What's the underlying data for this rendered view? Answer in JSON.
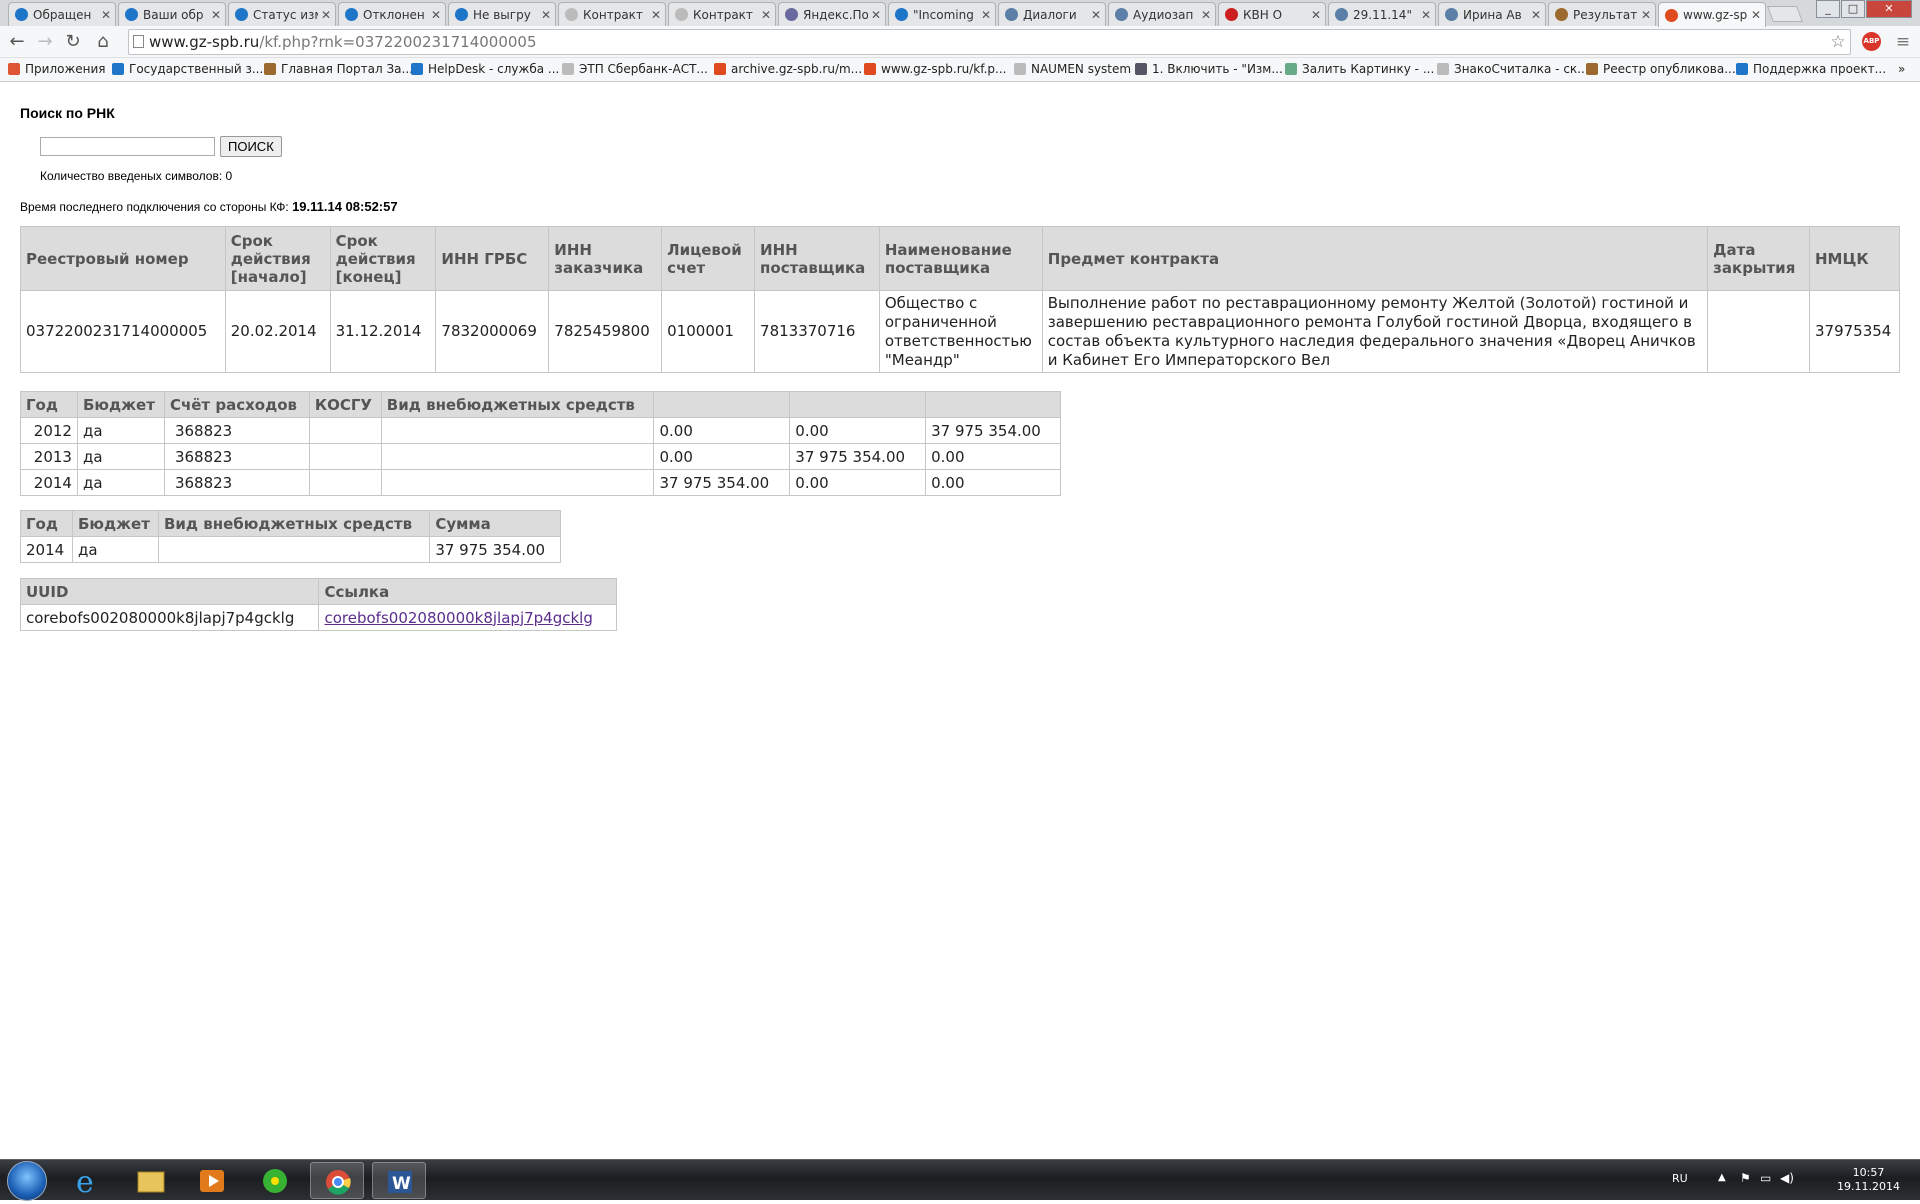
{
  "browser": {
    "tabs": [
      {
        "title": "Обращен",
        "color": "#1f76c9"
      },
      {
        "title": "Ваши обр",
        "color": "#1f76c9"
      },
      {
        "title": "Статус изм",
        "color": "#1f76c9"
      },
      {
        "title": "Отклонен",
        "color": "#1f76c9"
      },
      {
        "title": "Не выгру",
        "color": "#1f76c9"
      },
      {
        "title": "Контракт",
        "color": "#bbbbbb"
      },
      {
        "title": "Контракт",
        "color": "#bbbbbb"
      },
      {
        "title": "Яндекс.По",
        "color": "#6a6aa0"
      },
      {
        "title": "\"Incoming",
        "color": "#1f76c9"
      },
      {
        "title": "Диалоги",
        "color": "#5b7fa6"
      },
      {
        "title": "Аудиозап",
        "color": "#5b7fa6"
      },
      {
        "title": "КВН О",
        "color": "#cc1f1f"
      },
      {
        "title": "29.11.14\"",
        "color": "#5b7fa6"
      },
      {
        "title": "Ирина Ав",
        "color": "#5b7fa6"
      },
      {
        "title": "Результат",
        "color": "#9c6a2e"
      },
      {
        "title": "www.gz-sp",
        "color": "#e04a1f"
      }
    ],
    "url_host": "www.gz-spb.ru",
    "url_path": "/kf.php?rnk=0372200231714000005",
    "bookmarks": [
      {
        "label": "Приложения",
        "color": "#d53"
      },
      {
        "label": "Государственный з...",
        "color": "#1f76c9"
      },
      {
        "label": "Главная Портал За...",
        "color": "#9c6a2e"
      },
      {
        "label": "HelpDesk - служба ...",
        "color": "#1f76c9"
      },
      {
        "label": "ЭТП Сбербанк-АСТ...",
        "color": "#bbbbbb"
      },
      {
        "label": "archive.gz-spb.ru/m...",
        "color": "#e04a1f"
      },
      {
        "label": "www.gz-spb.ru/kf.p...",
        "color": "#e04a1f"
      },
      {
        "label": "NAUMEN system",
        "color": "#bbbbbb"
      },
      {
        "label": "1. Включить - \"Изм...",
        "color": "#556"
      },
      {
        "label": "Залить Картинку - ...",
        "color": "#6a8"
      },
      {
        "label": "ЗнакоСчиталка - ск...",
        "color": "#bbbbbb"
      },
      {
        "label": "Реестр опубликова...",
        "color": "#9c6a2e"
      },
      {
        "label": "Поддержка проект...",
        "color": "#1f76c9"
      }
    ]
  },
  "page": {
    "title": "Поиск по РНК",
    "search_value": "",
    "search_button": "ПОИСК",
    "char_count": "Количество введеных символов: 0",
    "last_conn_label": "Время последнего подключения со стороны КФ:",
    "last_conn_value": "19.11.14 08:52:57"
  },
  "contract_table": {
    "headers": [
      "Реестровый номер",
      "Срок действия [начало]",
      "Срок действия [конец]",
      "ИНН ГРБС",
      "ИНН заказчика",
      "Лицевой счет",
      "ИНН поставщика",
      "Наименование поставщика",
      "Предмет контракта",
      "Дата закрытия",
      "НМЦК"
    ],
    "row": [
      "0372200231714000005",
      "20.02.2014",
      "31.12.2014",
      "7832000069",
      "7825459800",
      "0100001",
      "7813370716",
      "Общество с ограниченной ответственностью \"Меандр\"",
      "Выполнение работ по реставрационному ремонту Желтой (Золотой) гостиной и завершению реставрационного ремонта Голубой гостиной Дворца, входящего в состав объекта культурного наследия федерального значения «Дворец Аничков и Кабинет Его Императорского Вел",
      "",
      "37975354"
    ]
  },
  "budget_table": {
    "headers": [
      "Год",
      "Бюджет",
      "Счёт расходов",
      "КОСГУ",
      "Вид внебюджетных средств",
      "",
      "",
      ""
    ],
    "rows": [
      [
        "2012",
        "да",
        "368823",
        "",
        "",
        "0.00",
        "0.00",
        "37 975 354.00"
      ],
      [
        "2013",
        "да",
        "368823",
        "",
        "",
        "0.00",
        "37 975 354.00",
        "0.00"
      ],
      [
        "2014",
        "да",
        "368823",
        "",
        "",
        "37 975 354.00",
        "0.00",
        "0.00"
      ]
    ]
  },
  "sum_table": {
    "headers": [
      "Год",
      "Бюджет",
      "Вид внебюджетных средств",
      "Сумма"
    ],
    "rows": [
      [
        "2014",
        "да",
        "",
        "37 975 354.00"
      ]
    ]
  },
  "uuid_table": {
    "headers": [
      "UUID",
      "Ссылка"
    ],
    "rows": [
      [
        "corebofs002080000k8jlapj7p4gcklg",
        "corebofs002080000k8jlapj7p4gcklg"
      ]
    ]
  },
  "taskbar": {
    "lang": "RU",
    "time": "10:57",
    "date": "19.11.2014"
  }
}
